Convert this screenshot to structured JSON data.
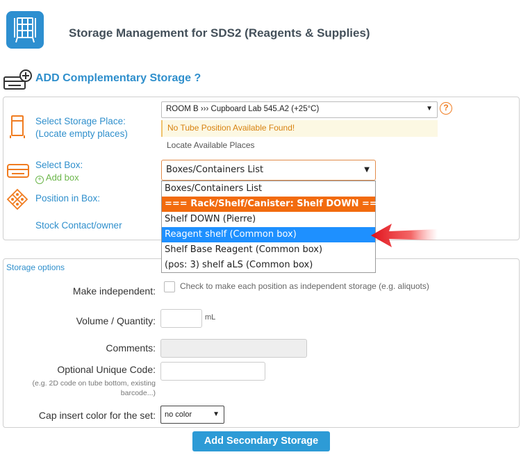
{
  "header": {
    "title": "Storage Management for SDS2 (Reagents & Supplies)",
    "icon": "storage-rack-icon"
  },
  "section": {
    "title": "ADD Complementary Storage ?",
    "icon": "add-storage-icon"
  },
  "storage_place": {
    "label": "Select Storage Place:",
    "sublabel": "(Locate empty places)",
    "value": "ROOM B ››› Cupboard Lab 545.A2 (+25°C)",
    "help": "?",
    "warning": "No Tube Position Available Found!",
    "locate_link": "Locate Available Places"
  },
  "box": {
    "label": "Select Box:",
    "add_link": "Add box",
    "selected": "Boxes/Containers List",
    "options": [
      {
        "label": "Boxes/Containers List",
        "kind": "normal"
      },
      {
        "label": "=== Rack/Shelf/Canister: Shelf DOWN ===",
        "kind": "group"
      },
      {
        "label": "Shelf DOWN (Pierre)",
        "kind": "normal"
      },
      {
        "label": "Reagent shelf (Common box)",
        "kind": "selected"
      },
      {
        "label": "Shelf Base Reagent (Common box)",
        "kind": "normal"
      },
      {
        "label": "(pos: 3) shelf aLS (Common box)",
        "kind": "normal"
      }
    ]
  },
  "position": {
    "label": "Position in Box:"
  },
  "contact": {
    "label": "Stock Contact/owner"
  },
  "options": {
    "title": "Storage options",
    "independent_label": "Make independent:",
    "independent_text": "Check to make each position as independent storage (e.g. aliquots)",
    "volume_label": "Volume / Quantity:",
    "volume_unit": "mL",
    "comments_label": "Comments:",
    "code_label": "Optional Unique Code:",
    "code_hint": "(e.g. 2D code on tube bottom, existing barcode...)",
    "cap_label": "Cap insert color for the set:",
    "cap_value": "no color"
  },
  "submit_label": "Add Secondary Storage",
  "colors": {
    "accent": "#2f8fcc",
    "orange": "#f26b0e",
    "selected": "#1e90ff",
    "button": "#2d9bd6"
  }
}
